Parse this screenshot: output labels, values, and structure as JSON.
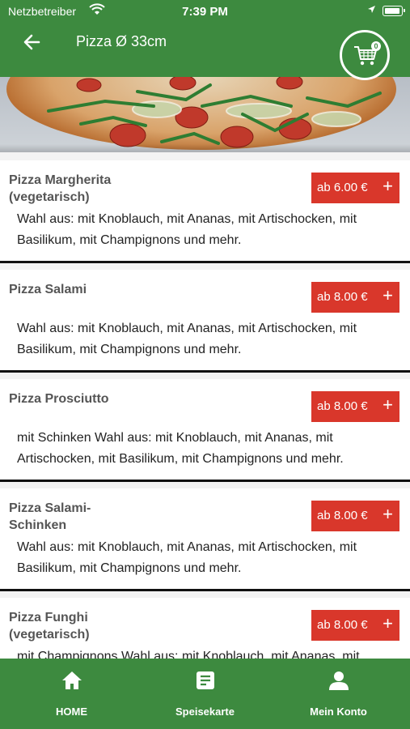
{
  "status": {
    "carrier": "Netzbetreiber",
    "time": "7:39 PM"
  },
  "header": {
    "title": "Pizza Ø 33cm",
    "cart_count": "0"
  },
  "products": [
    {
      "name": "Pizza Margherita (vegetarisch)",
      "price": "ab 6.00 €",
      "desc": "Wahl aus: mit Knoblauch, mit Ananas, mit Artischocken, mit Basilikum, mit Champignons und mehr."
    },
    {
      "name": "Pizza Salami",
      "price": "ab 8.00 €",
      "desc": "Wahl aus: mit Knoblauch, mit Ananas, mit Artischocken, mit Basilikum, mit Champignons und mehr."
    },
    {
      "name": "Pizza Prosciutto",
      "price": "ab 8.00 €",
      "desc": "mit Schinken Wahl aus: mit Knoblauch, mit Ananas, mit Artischocken, mit Basilikum, mit Champignons und mehr."
    },
    {
      "name": "Pizza Salami-Schinken",
      "price": "ab 8.00 €",
      "desc": "Wahl aus: mit Knoblauch, mit Ananas, mit Artischocken, mit Basilikum, mit Champignons und mehr."
    },
    {
      "name": "Pizza Funghi (vegetarisch)",
      "price": "ab 8.00 €",
      "desc": "mit Champignons Wahl aus: mit Knoblauch, mit Ananas, mit"
    }
  ],
  "tabs": [
    {
      "label": "HOME",
      "icon": "home-icon"
    },
    {
      "label": "Speisekarte",
      "icon": "menu-card-icon"
    },
    {
      "label": "Mein Konto",
      "icon": "account-icon"
    }
  ],
  "colors": {
    "brand_green": "#3d8a3f",
    "price_red": "#d9372b"
  }
}
